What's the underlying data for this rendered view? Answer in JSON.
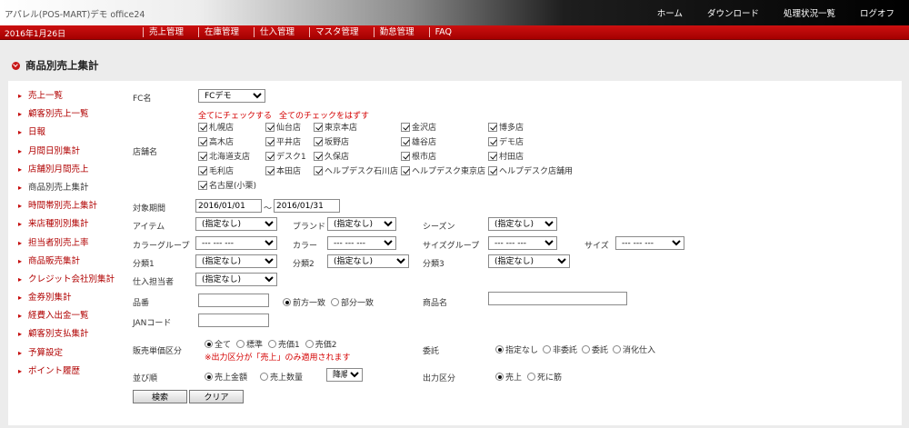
{
  "app_title": "アパレル(POS-MART)デモ office24",
  "top_nav": [
    "ホーム",
    "ダウンロード",
    "処理状況一覧",
    "ログオフ"
  ],
  "date": "2016年1月26日",
  "main_menu": [
    "売上管理",
    "在庫管理",
    "仕入管理",
    "マスタ管理",
    "勤怠管理",
    "FAQ"
  ],
  "page_title": "商品別売上集計",
  "sidebar": [
    "売上一覧",
    "顧客別売上一覧",
    "日報",
    "月間日別集計",
    "店舗別月間売上",
    "商品別売上集計",
    "時間帯別売上集計",
    "来店種別別集計",
    "担当者別売上率",
    "商品販売集計",
    "クレジット会社別集計",
    "金券別集計",
    "経費入出金一覧",
    "顧客別支払集計",
    "予算設定",
    "ポイント履歴"
  ],
  "sidebar_active": 5,
  "form": {
    "fc_label": "FC名",
    "fc_value": "FCデモ",
    "check_all": "全てにチェックする",
    "uncheck_all": "全てのチェックをはずす",
    "store_label": "店舗名",
    "stores": [
      [
        "札幌店",
        "仙台店",
        "東京本店",
        "金沢店",
        "博多店"
      ],
      [
        "高木店",
        "平井店",
        "坂野店",
        "雄谷店",
        "デモ店"
      ],
      [
        "北海道支店",
        "デスク1",
        "久保店",
        "根市店",
        "村田店"
      ],
      [
        "毛利店",
        "本田店",
        "ヘルプデスク石川店",
        "ヘルプデスク東京店",
        "ヘルプデスク店舗用"
      ],
      [
        "名古屋(小栗)"
      ]
    ],
    "period_label": "対象期間",
    "period_from": "2016/01/01",
    "period_sep": "～",
    "period_to": "2016/01/31",
    "item_label": "アイテム",
    "brand_label": "ブランド",
    "season_label": "シーズン",
    "color_group_label": "カラーグループ",
    "color_label": "カラー",
    "size_group_label": "サイズグループ",
    "size_label": "サイズ",
    "cat1_label": "分類1",
    "cat2_label": "分類2",
    "cat3_label": "分類3",
    "buyer_label": "仕入担当者",
    "unspecified": "(指定なし)",
    "dashes": "--- --- ---",
    "product_code_label": "品番",
    "match_options": [
      "前方一致",
      "部分一致"
    ],
    "match_selected": 0,
    "product_name_label": "商品名",
    "jan_label": "JANコード",
    "price_type_label": "販売単価区分",
    "price_type_options": [
      "全て",
      "標準",
      "売価1",
      "売価2"
    ],
    "price_type_selected": 0,
    "price_note": "※出力区分が「売上」のみ適用されます",
    "consign_label": "委託",
    "consign_options": [
      "指定なし",
      "非委託",
      "委託",
      "消化仕入"
    ],
    "consign_selected": 0,
    "sort_label": "並び順",
    "sort_options": [
      "売上金額",
      "売上数量"
    ],
    "sort_selected": 0,
    "sort_dir": "降順",
    "output_label": "出力区分",
    "output_options": [
      "売上",
      "死に筋"
    ],
    "output_selected": 0,
    "search_button": "検索",
    "clear_button": "クリア"
  }
}
